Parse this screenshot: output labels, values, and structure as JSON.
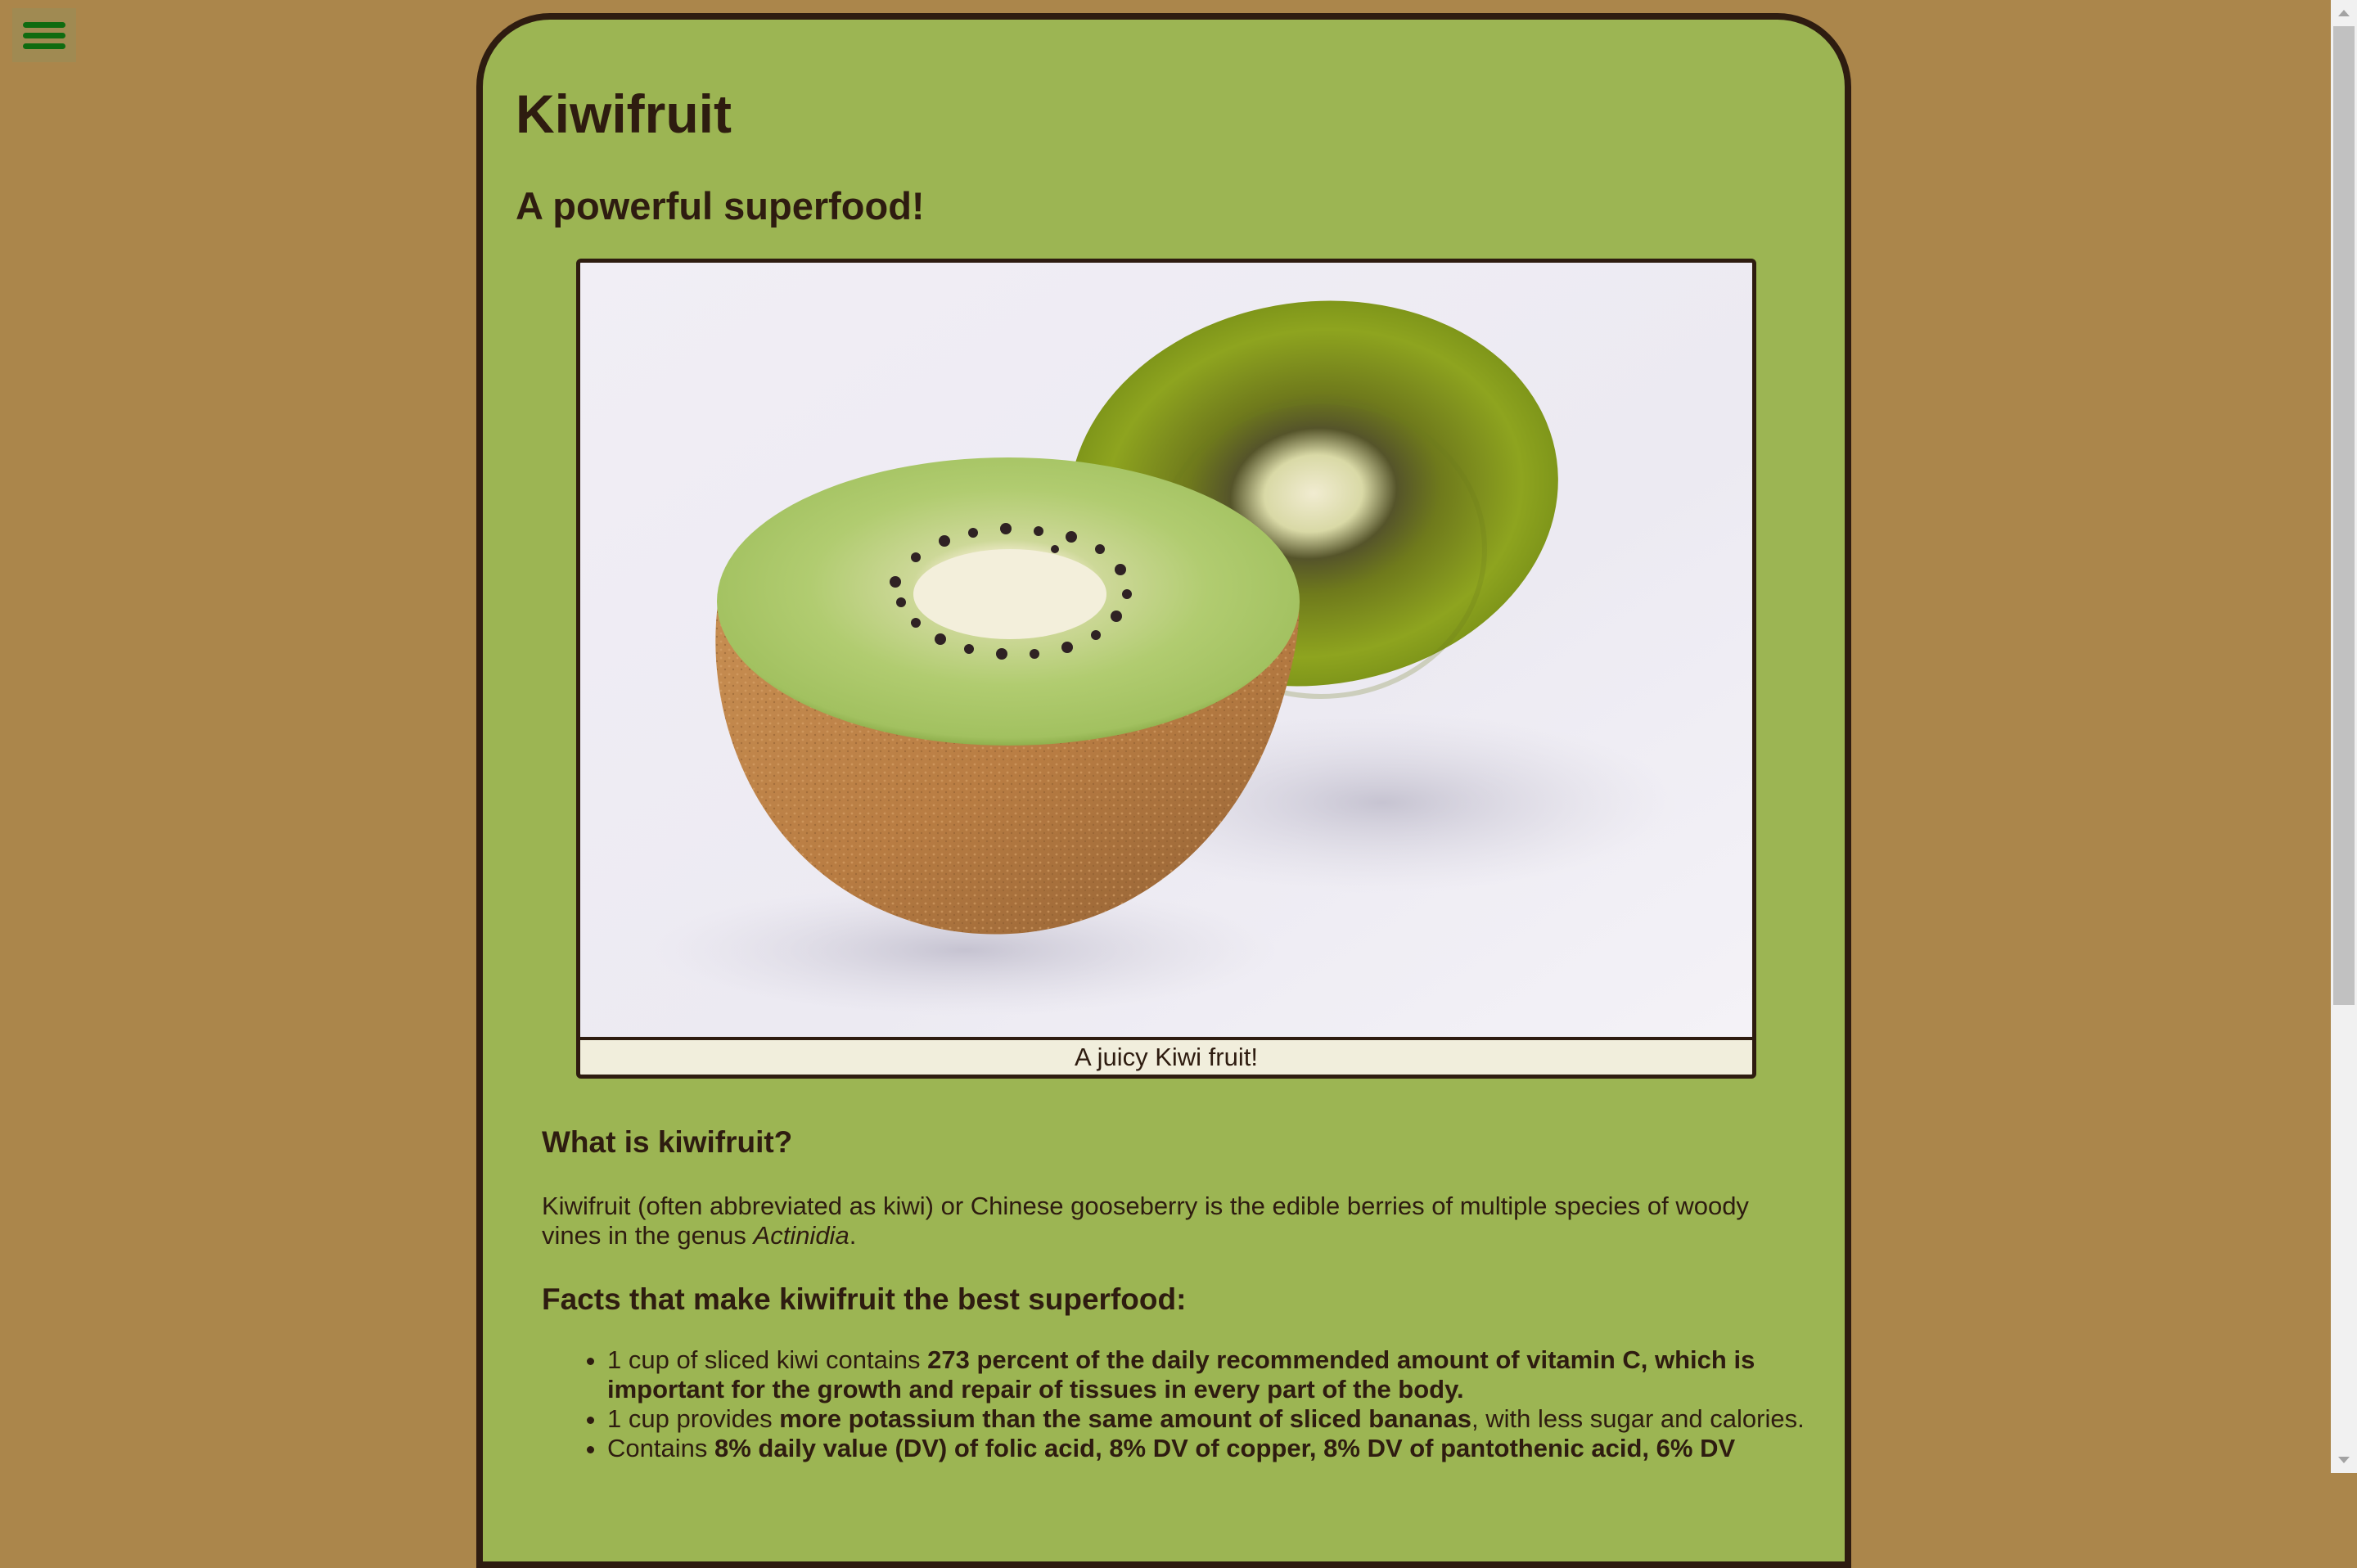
{
  "menu": {
    "icon": "hamburger-menu-icon"
  },
  "page": {
    "title": "Kiwifruit",
    "subtitle": "A powerful superfood!"
  },
  "figure": {
    "image_alt": "Two halves of a kiwi fruit",
    "caption": "A juicy Kiwi fruit!"
  },
  "sections": {
    "what_heading": "What is kiwifruit?",
    "intro_before": "Kiwifruit (often abbreviated as kiwi) or Chinese gooseberry is the edible berries of multiple species of woody vines in the genus ",
    "intro_genus": "Actinidia",
    "intro_after": ".",
    "facts_heading": "Facts that make kiwifruit the best superfood:"
  },
  "facts": [
    {
      "plain": "1 cup of sliced kiwi contains ",
      "bold": "273 percent of the daily recommended amount of vitamin C, which is important for the growth and repair of tissues in every part of the body.",
      "tail": ""
    },
    {
      "plain": "1 cup provides ",
      "bold": "more potassium than the same amount of sliced bananas",
      "tail": ", with less sugar and calories."
    },
    {
      "plain": "Contains ",
      "bold": "8% daily value (DV) of folic acid, 8% DV of copper, 8% DV of pantothenic acid, 6% DV",
      "tail": ""
    }
  ],
  "colors": {
    "page_background": "#ab864b",
    "card_background": "#9cb553",
    "card_border": "#2e1c10",
    "caption_background": "#f1eedc",
    "menu_icon": "#0f6b10"
  }
}
